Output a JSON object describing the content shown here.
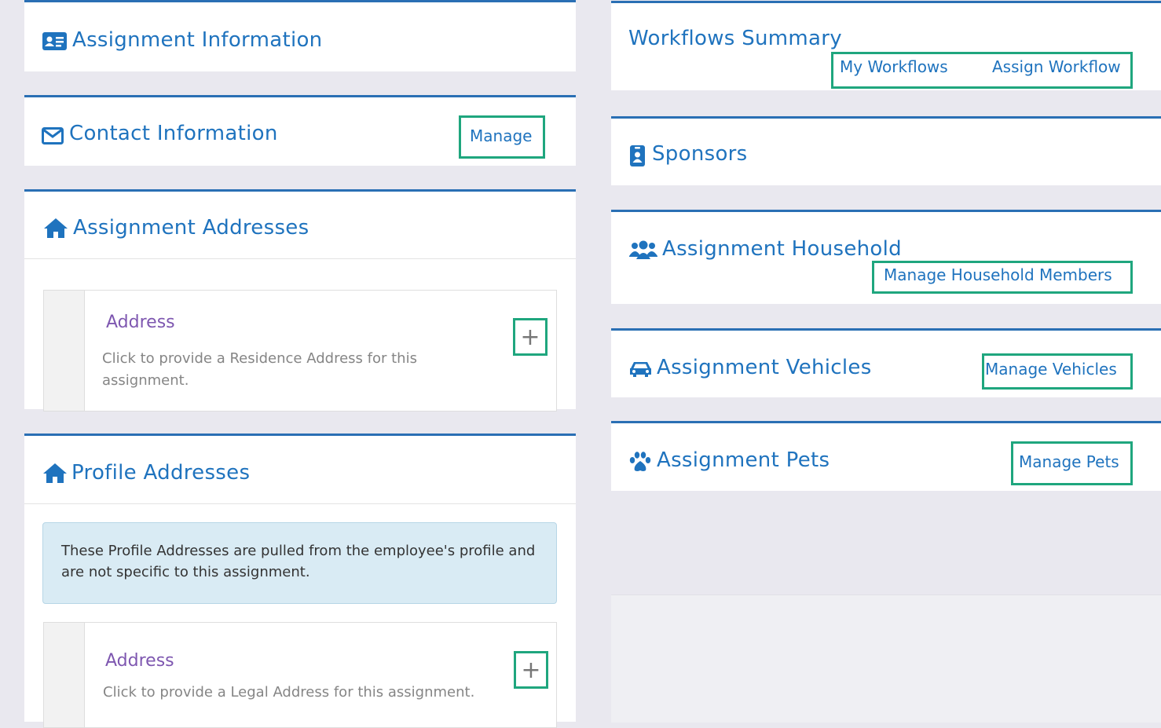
{
  "left": {
    "assignment_information": {
      "title": "Assignment Information",
      "icon": "id-card-icon"
    },
    "contact_information": {
      "title": "Contact Information",
      "icon": "envelope-icon",
      "manage_label": "Manage"
    },
    "assignment_addresses": {
      "title": "Assignment Addresses",
      "icon": "home-icon",
      "card": {
        "title": "Address",
        "description": "Click to provide a Residence Address for this assignment.",
        "add_label": "+"
      }
    },
    "profile_addresses": {
      "title": "Profile Addresses",
      "icon": "home-icon",
      "info": "These Profile Addresses are pulled from the employee's profile and are not specific to this assignment.",
      "card": {
        "title": "Address",
        "description": "Click to provide a Legal Address for this assignment.",
        "add_label": "+"
      }
    }
  },
  "right": {
    "workflows_summary": {
      "title": "Workflows Summary",
      "my_workflows_label": "My Workflows",
      "assign_workflow_label": "Assign Workflow"
    },
    "sponsors": {
      "title": "Sponsors",
      "icon": "badge-icon"
    },
    "household": {
      "title": "Assignment Household",
      "icon": "users-icon",
      "manage_label": "Manage Household Members"
    },
    "vehicles": {
      "title": "Assignment Vehicles",
      "icon": "car-icon",
      "manage_label": "Manage Vehicles"
    },
    "pets": {
      "title": "Assignment Pets",
      "icon": "paw-icon",
      "manage_label": "Manage Pets"
    }
  },
  "colors": {
    "accent": "#1f73be",
    "highlight": "#1fa67e",
    "card_title": "#7e57b0",
    "background": "#e9e8ef"
  }
}
